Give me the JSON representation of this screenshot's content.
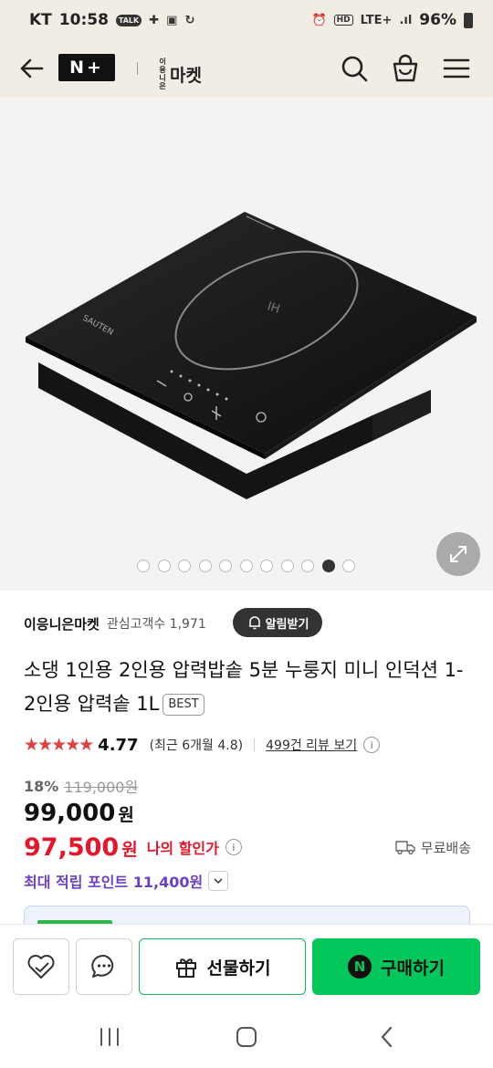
{
  "status": {
    "carrier": "KT",
    "time": "10:58",
    "talk_badge": "TALK",
    "network": "LTE+",
    "hd": "HD",
    "battery": "96%"
  },
  "header": {
    "nplus_logo": "N+",
    "brand_logo_small": "이응니은",
    "brand_logo_main": "마켓",
    "icons": [
      "back-arrow-icon",
      "search-icon",
      "shopping-bag-icon",
      "menu-icon"
    ]
  },
  "gallery": {
    "dot_count": 11,
    "active_index": 9
  },
  "product": {
    "store_name": "이응니은마켓",
    "followers_label": "관심고객수 1,971",
    "alarm_button": "알림받기",
    "title": "소댕 1인용 2인용 압력밥솥 5분 누룽지 미니 인덕션 1-2인용 압력솥 1L",
    "badge": "BEST",
    "stars": "★★★★★",
    "rating": "4.77",
    "recent_rating": "(최근 6개월 4.8)",
    "review_link": "499건 리뷰 보기",
    "info_symbol": "i",
    "discount_rate": "18%",
    "original_price": "119,000원",
    "price": "99,000",
    "price_unit": "원",
    "my_price": "97,500",
    "my_price_unit": "원",
    "my_price_label": "나의 할인가",
    "shipping": "무료배송",
    "points_label": "최대 적립 포인트 11,400원"
  },
  "actions": {
    "gift": "선물하기",
    "buy": "구매하기",
    "buy_logo": "N"
  },
  "colors": {
    "header_bg": "#f2ede4",
    "accent_red": "#e4162a",
    "naver_green": "#03c75a",
    "points_purple": "#6c3fc7"
  }
}
